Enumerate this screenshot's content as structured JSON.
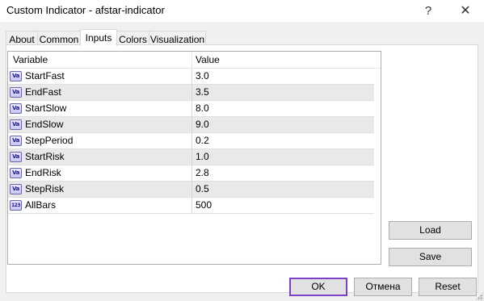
{
  "window": {
    "title": "Custom Indicator - afstar-indicator",
    "help_glyph": "?",
    "close_glyph": "✕"
  },
  "tabs": [
    {
      "label": "About"
    },
    {
      "label": "Common"
    },
    {
      "label": "Inputs",
      "active": true
    },
    {
      "label": "Colors"
    },
    {
      "label": "Visualization"
    }
  ],
  "grid": {
    "headers": {
      "variable": "Variable",
      "value": "Value"
    },
    "rows": [
      {
        "icon": "variable-icon",
        "icon_text": "Va",
        "name": "StartFast",
        "value": "3.0"
      },
      {
        "icon": "variable-icon",
        "icon_text": "Va",
        "name": "EndFast",
        "value": "3.5"
      },
      {
        "icon": "variable-icon",
        "icon_text": "Va",
        "name": "StartSlow",
        "value": "8.0"
      },
      {
        "icon": "variable-icon",
        "icon_text": "Va",
        "name": "EndSlow",
        "value": "9.0"
      },
      {
        "icon": "variable-icon",
        "icon_text": "Va",
        "name": "StepPeriod",
        "value": "0.2"
      },
      {
        "icon": "variable-icon",
        "icon_text": "Va",
        "name": "StartRisk",
        "value": "1.0"
      },
      {
        "icon": "variable-icon",
        "icon_text": "Va",
        "name": "EndRisk",
        "value": "2.8"
      },
      {
        "icon": "variable-icon",
        "icon_text": "Va",
        "name": "StepRisk",
        "value": "0.5"
      },
      {
        "icon": "integer-icon",
        "icon_text": "123",
        "name": "AllBars",
        "value": "500"
      }
    ]
  },
  "buttons": {
    "load": "Load",
    "save": "Save",
    "ok": "OK",
    "cancel": "Отмена",
    "reset": "Reset"
  },
  "colors": {
    "ok_border": "#7b3fc8",
    "alt_row": "#e9e9e9",
    "dialog_bg": "#f0f0f0"
  }
}
